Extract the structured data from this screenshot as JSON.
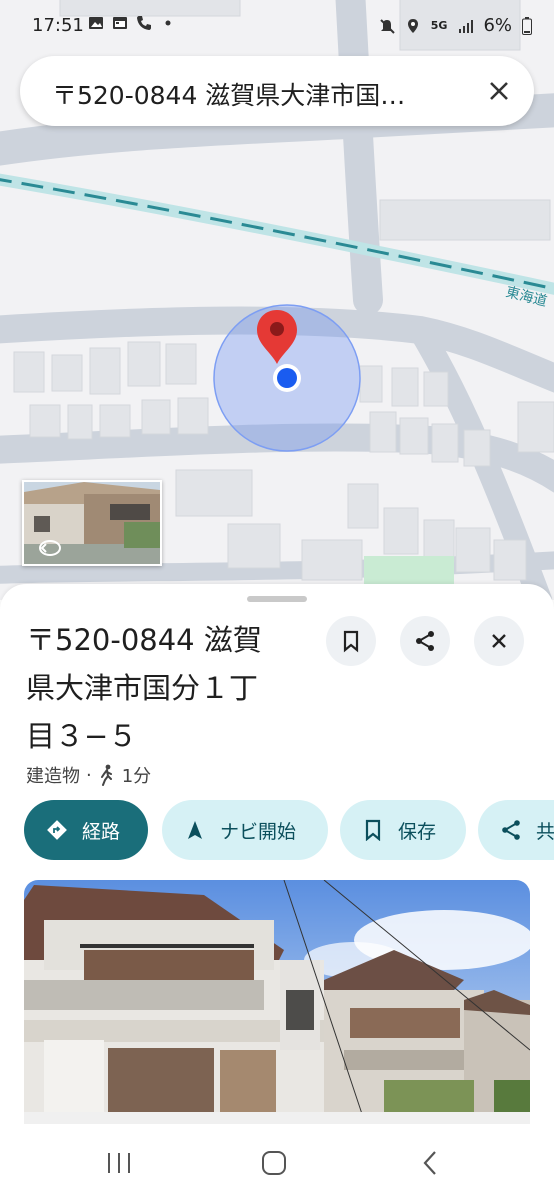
{
  "status_bar": {
    "time": "17:51",
    "network": "5G",
    "battery": "6%"
  },
  "search": {
    "query": "〒520-0844 滋賀県大津市国…"
  },
  "map": {
    "railway_label": "東海道"
  },
  "place": {
    "title_line1": "〒520-0844 滋賀",
    "title_line2": "県大津市国分１丁",
    "title_line3": "目３−５",
    "category": "建造物",
    "separator": "·",
    "walk_time": "1分"
  },
  "actions": {
    "directions": "経路",
    "navigate": "ナビ開始",
    "save": "保存",
    "share": "共"
  },
  "colors": {
    "primary": "#1a6e7a",
    "chip_bg": "#d6f1f5",
    "location_blue": "#1a5cf0",
    "pin_red": "#e53935"
  }
}
